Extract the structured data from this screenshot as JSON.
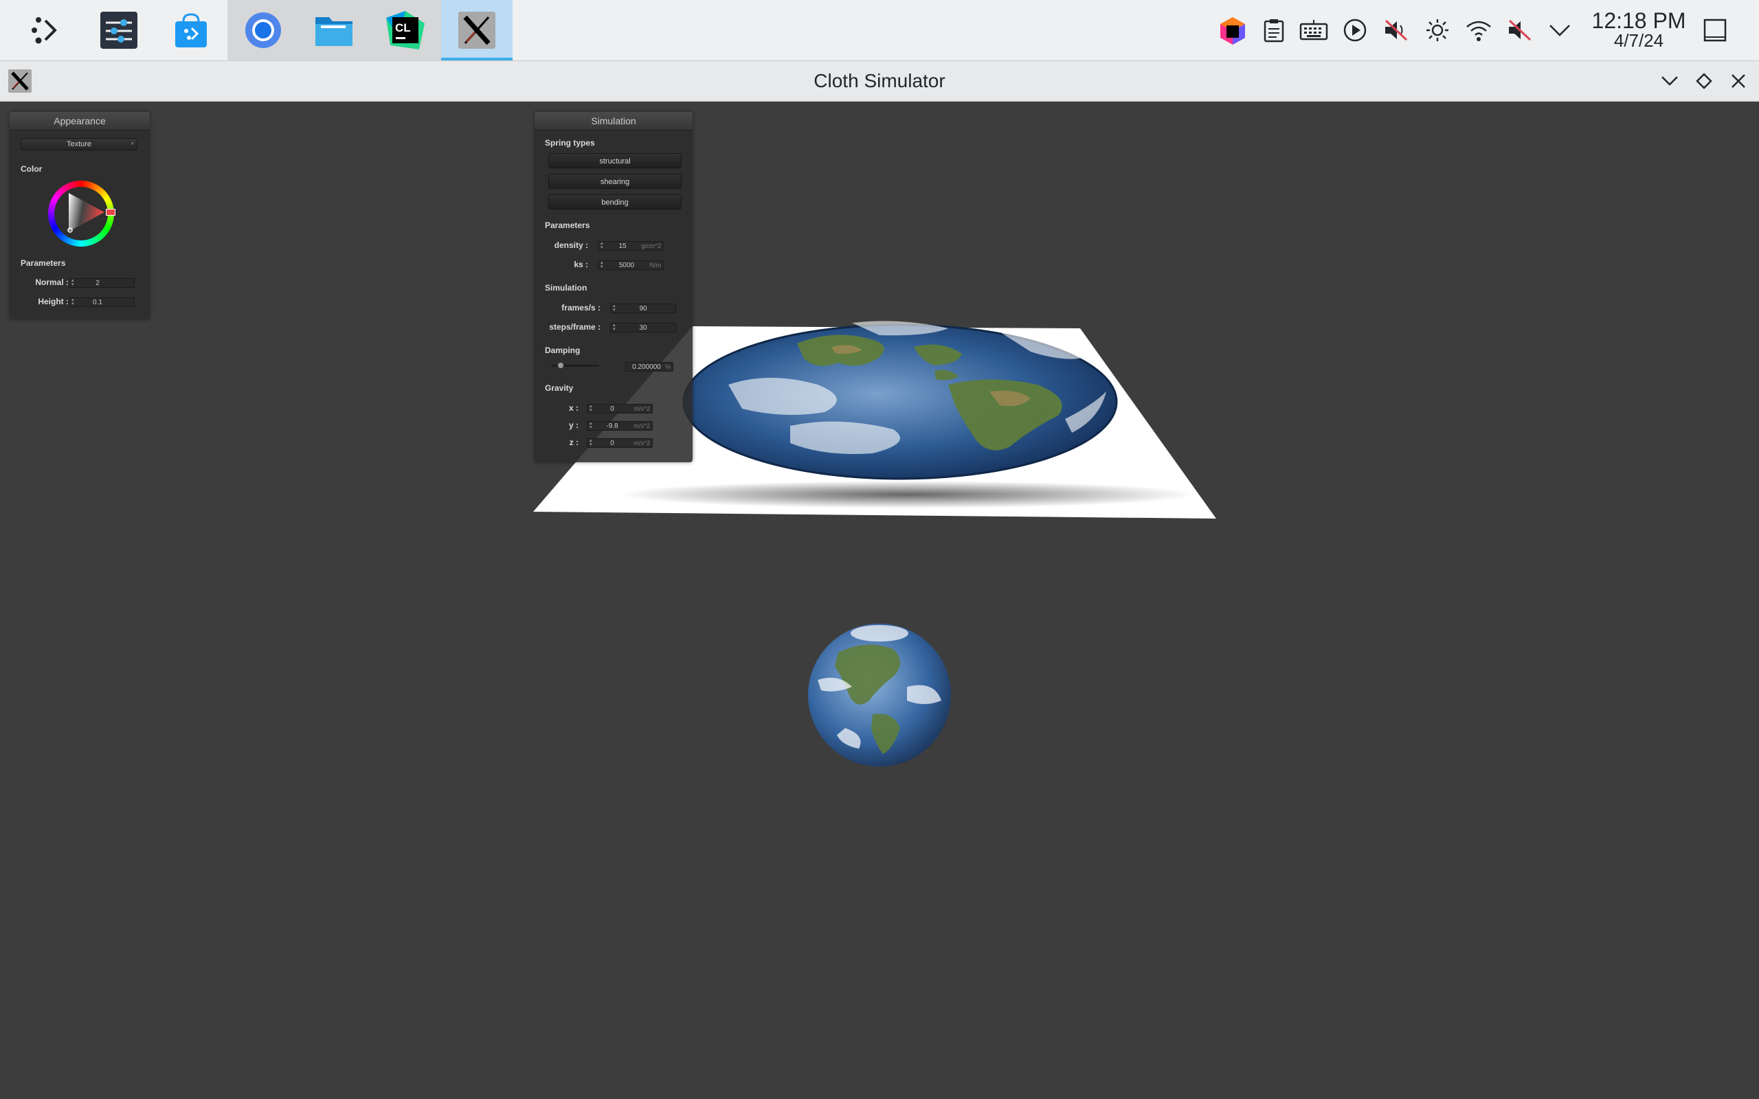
{
  "taskbar": {
    "clock_time": "12:18 PM",
    "clock_date": "4/7/24",
    "apps": [
      {
        "icon": "app-launcher-icon"
      },
      {
        "icon": "system-settings-icon"
      },
      {
        "icon": "discover-store-icon"
      },
      {
        "icon": "chromium-browser-icon"
      },
      {
        "icon": "file-manager-icon"
      },
      {
        "icon": "clion-icon",
        "text": "CL"
      },
      {
        "icon": "x-app-icon"
      }
    ],
    "tray": [
      "jetbrains-toolbox-icon",
      "clipboard-icon",
      "keyboard-icon",
      "media-play-icon",
      "volume-muted-icon",
      "brightness-icon",
      "wifi-icon",
      "microphone-muted-icon",
      "expand-tray-icon",
      "show-desktop-icon"
    ]
  },
  "window": {
    "title": "Cloth Simulator"
  },
  "appearance": {
    "title": "Appearance",
    "mode": "Texture",
    "color_label": "Color",
    "params_label": "Parameters",
    "normal_label": "Normal :",
    "normal_value": "2",
    "height_label": "Height :",
    "height_value": "0.1",
    "colors": {
      "marker": "#e94545"
    }
  },
  "simulation": {
    "title": "Simulation",
    "spring_types_label": "Spring types",
    "spring_types": [
      "structural",
      "shearing",
      "bending"
    ],
    "parameters_label": "Parameters",
    "density_label": "density :",
    "density_value": "15",
    "density_unit": "g/cm^2",
    "ks_label": "ks :",
    "ks_value": "5000",
    "ks_unit": "N/m",
    "simulation_label": "Simulation",
    "fps_label": "frames/s :",
    "fps_value": "90",
    "steps_label": "steps/frame :",
    "steps_value": "30",
    "damping_label": "Damping",
    "damping_value": "0.200000",
    "damping_unit": "%",
    "damping_fraction": 0.2,
    "gravity_label": "Gravity",
    "gx_label": "x :",
    "gx_value": "0",
    "gy_label": "y :",
    "gy_value": "-9.8",
    "gz_label": "z :",
    "gz_value": "0",
    "gravity_unit": "m/s^2"
  }
}
